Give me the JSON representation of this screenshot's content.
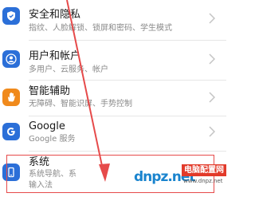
{
  "settings": {
    "items": [
      {
        "title": "安全和隐私",
        "subtitle": "指纹、人脸解锁、锁屏和密码、学生模式",
        "icon": "shield-icon",
        "color": "#2b6fd8"
      },
      {
        "title": "用户和帐户",
        "subtitle": "多用户、云服务、帐户",
        "icon": "user-icon",
        "color": "#2b6fd8"
      },
      {
        "title": "智能辅助",
        "subtitle": "无障碍、智能识屏、手势控制",
        "icon": "hand-icon",
        "color": "#f08a1c"
      },
      {
        "title": "Google",
        "subtitle": "Google 服务",
        "icon": "google-icon",
        "color": "#2b6fd8"
      },
      {
        "title": "系统",
        "subtitle": "系统导航、系",
        "subtitle2": "输入法",
        "icon": "phone-icon",
        "color": "#2b6fd8"
      }
    ]
  },
  "watermark": {
    "brand": "dnpz.net",
    "tag": "电脑配置网",
    "url": "www.dnpz.net"
  },
  "annotation": {
    "highlight_color": "#e64a4a",
    "arrow_color": "#e64a4a"
  }
}
